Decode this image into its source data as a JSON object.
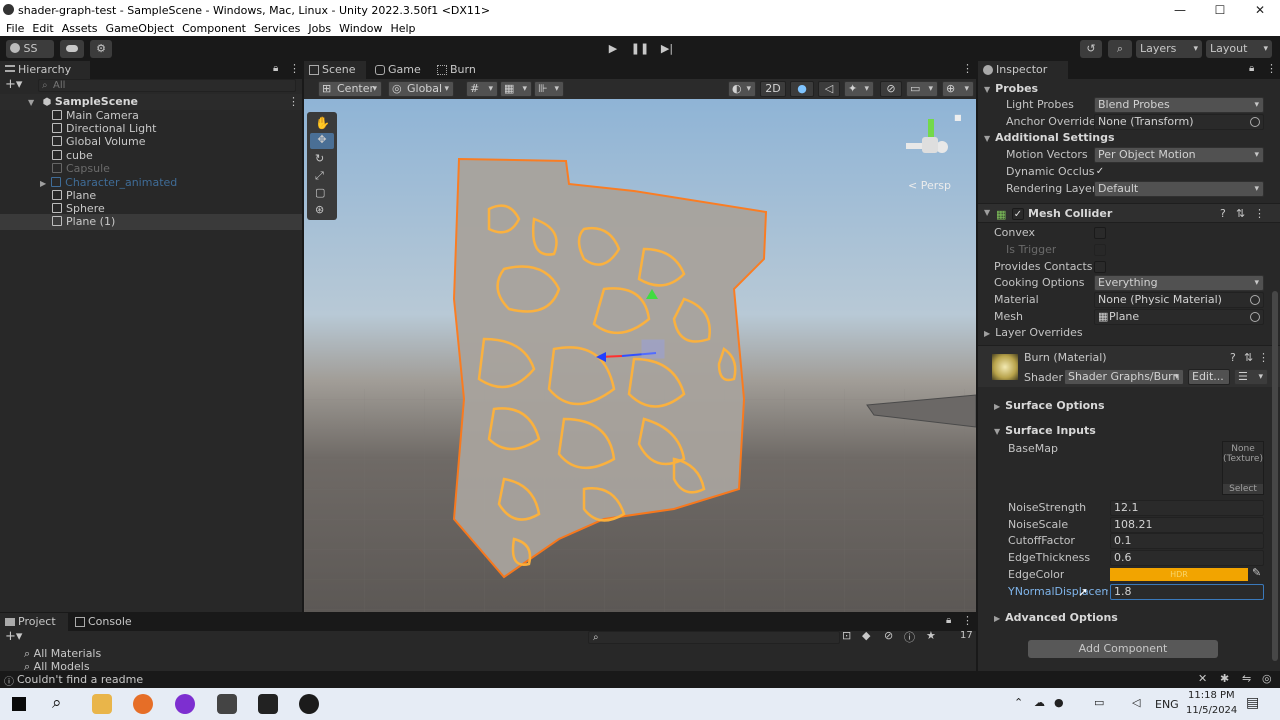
{
  "window": {
    "title": "shader-graph-test - SampleScene - Windows, Mac, Linux - Unity 2022.3.50f1 <DX11>",
    "min": "—",
    "max": "☐",
    "close": "✕"
  },
  "menu": [
    "File",
    "Edit",
    "Assets",
    "GameObject",
    "Component",
    "Services",
    "Jobs",
    "Window",
    "Help"
  ],
  "toolbar": {
    "account": "SS",
    "layers": "Layers",
    "layout": "Layout"
  },
  "hierarchy": {
    "tab": "Hierarchy",
    "search_placeholder": "All",
    "scene": "SampleScene",
    "items": [
      "Main Camera",
      "Directional Light",
      "Global Volume",
      "cube",
      "Capsule",
      "Character_animated",
      "Plane",
      "Sphere",
      "Plane (1)"
    ]
  },
  "scene_tabs": {
    "scene": "Scene",
    "game": "Game",
    "burn": "Burn",
    "pivot": "Center",
    "space": "Global",
    "mode_2d": "2D",
    "persp": "< Persp"
  },
  "inspector": {
    "tab": "Inspector",
    "probes": "Probes",
    "light_probes_label": "Light Probes",
    "light_probes_value": "Blend Probes",
    "anchor_label": "Anchor Override",
    "anchor_value": "None (Transform)",
    "additional": "Additional Settings",
    "motion_label": "Motion Vectors",
    "motion_value": "Per Object Motion",
    "dynamic_label": "Dynamic Occlusic",
    "rendering_label": "Rendering Layer N",
    "rendering_value": "Default",
    "mesh_collider": "Mesh Collider",
    "convex": "Convex",
    "is_trigger": "Is Trigger",
    "provides": "Provides Contacts",
    "cooking_label": "Cooking Options",
    "cooking_value": "Everything",
    "material_label": "Material",
    "material_value": "None (Physic Material)",
    "mesh_label": "Mesh",
    "mesh_value": "Plane",
    "layer_overrides": "Layer Overrides",
    "burn_material": "Burn (Material)",
    "shader_label": "Shader",
    "shader_value": "Shader Graphs/Burn",
    "edit": "Edit...",
    "surface_options": "Surface Options",
    "surface_inputs": "Surface Inputs",
    "basemap": "BaseMap",
    "tex_none": "None",
    "tex_type": "(Texture)",
    "select": "Select",
    "props": [
      {
        "label": "NoiseStrength",
        "value": "12.1"
      },
      {
        "label": "NoiseScale",
        "value": "108.21"
      },
      {
        "label": "CutoffFactor",
        "value": "0.1"
      },
      {
        "label": "EdgeThickness",
        "value": "0.6"
      }
    ],
    "edgecolor": "EdgeColor",
    "hdr": "HDR",
    "ynormal_label": "YNormalDisplacemer",
    "ynormal_value": "1.8",
    "advanced": "Advanced Options",
    "add_component": "Add Component"
  },
  "project": {
    "tab": "Project",
    "console": "Console",
    "items": [
      "All Materials",
      "All Models"
    ],
    "count": "17"
  },
  "status": {
    "message": "Couldn't find a readme"
  },
  "taskbar": {
    "lang": "ENG",
    "time": "11:18 PM",
    "date": "11/5/2024"
  },
  "colors": {
    "accent": "#2c5d87",
    "edge_color": "#f2a400"
  }
}
